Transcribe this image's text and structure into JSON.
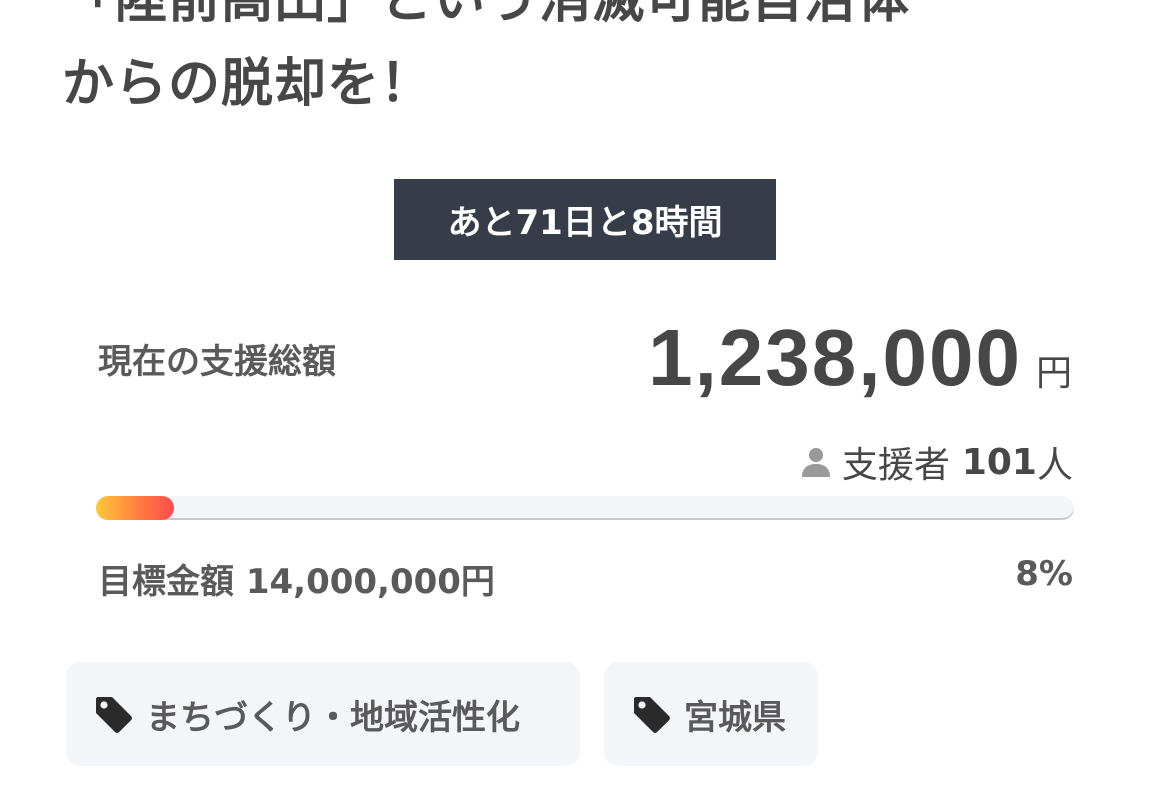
{
  "title": {
    "line1": "「陸前高田」という消滅可能自治体",
    "line2": "からの脱却を！"
  },
  "countdown": "あと71日と8時間",
  "raised": {
    "label": "現在の支援総額",
    "amount": "1,238,000",
    "unit": "円"
  },
  "supporters": {
    "label": "支援者",
    "count": "101",
    "suffix": "人",
    "icon": "person-icon"
  },
  "progress": {
    "percent_value": 8,
    "percent_label": "8%"
  },
  "goal": {
    "text": "目標金額 14,000,000円"
  },
  "tags": [
    {
      "label": "まちづくり・地域活性化",
      "icon": "tag-icon"
    },
    {
      "label": "宮城県",
      "icon": "tag-icon"
    }
  ],
  "colors": {
    "countdown_bg": "#363d48",
    "text": "#474747",
    "progress_start": "#ffc93c",
    "progress_end": "#ff4a4a",
    "tag_bg": "#f4f5f8"
  }
}
